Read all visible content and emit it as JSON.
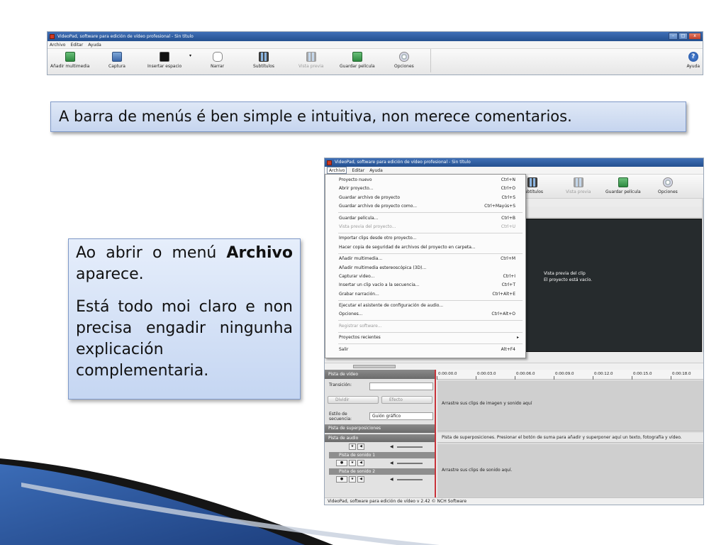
{
  "top_app": {
    "title": "VideoPad, software para edición de vídeo profesional - Sin título",
    "menu": [
      "Archivo",
      "Editar",
      "Ayuda"
    ],
    "toolbar": [
      {
        "label": "Añadir multimedia",
        "icon": "add-media-icon"
      },
      {
        "label": "Captura",
        "icon": "capture-icon"
      },
      {
        "label": "Insertar espacio",
        "icon": "insert-space-icon"
      },
      {
        "label": "Narrar",
        "icon": "narrate-icon"
      },
      {
        "label": "Subtítulos",
        "icon": "subtitles-icon"
      },
      {
        "label": "Vista previa",
        "icon": "preview-icon"
      },
      {
        "label": "Guardar película",
        "icon": "save-movie-icon"
      },
      {
        "label": "Opciones",
        "icon": "options-icon"
      },
      {
        "label": "Ayuda",
        "icon": "help-icon"
      }
    ]
  },
  "banner": {
    "text": "A barra de menús é ben simple e intuitiva, non merece comentarios."
  },
  "textbox": {
    "p1_pre": "Ao abrir o menú ",
    "p1_bold": "Archivo",
    "p1_post": " aparece.",
    "p2": "Está todo moi claro e non precisa engadir ningunha explicación complementaria."
  },
  "shot": {
    "title": "VideoPad, software para edición de vídeo profesional - Sin título",
    "menu": [
      "Archivo",
      "Editar",
      "Ayuda"
    ],
    "toolbar": [
      "Subtítulos",
      "Vista previa",
      "Guardar película",
      "Opciones"
    ],
    "dropdown": [
      {
        "label": "Proyecto nuevo",
        "shortcut": "Ctrl+N"
      },
      {
        "label": "Abrir proyecto...",
        "shortcut": "Ctrl+O"
      },
      {
        "label": "Guardar archivo de proyecto",
        "shortcut": "Ctrl+S"
      },
      {
        "label": "Guardar archivo de proyecto como...",
        "shortcut": "Ctrl+Mayús+S"
      },
      {
        "sep": true
      },
      {
        "label": "Guardar película...",
        "shortcut": "Ctrl+B"
      },
      {
        "label": "Vista previa del proyecto...",
        "shortcut": "Ctrl+U",
        "disabled": true
      },
      {
        "sep": true
      },
      {
        "label": "Importar clips desde otro proyecto...",
        "shortcut": ""
      },
      {
        "label": "Hacer copia de seguridad de archivos del proyecto en carpeta...",
        "shortcut": ""
      },
      {
        "sep": true
      },
      {
        "label": "Añadir multimedia...",
        "shortcut": "Ctrl+M"
      },
      {
        "label": "Añadir multimedia estereoscópica (3D)...",
        "shortcut": ""
      },
      {
        "label": "Capturar video...",
        "shortcut": "Ctrl+I"
      },
      {
        "label": "Insertar un clip vacío a la secuencia...",
        "shortcut": "Ctrl+T"
      },
      {
        "label": "Grabar narración...",
        "shortcut": "Ctrl+Alt+E"
      },
      {
        "sep": true
      },
      {
        "label": "Ejecutar el asistente de configuración de audio...",
        "shortcut": ""
      },
      {
        "label": "Opciones...",
        "shortcut": "Ctrl+Alt+O"
      },
      {
        "sep": true
      },
      {
        "label": "Registrar software...",
        "shortcut": "",
        "disabled": true
      },
      {
        "sep": true
      },
      {
        "label": "Proyectos recientes",
        "shortcut": "",
        "submenu": true
      },
      {
        "sep": true
      },
      {
        "label": "Salir",
        "shortcut": "Alt+F4"
      }
    ],
    "preview_text": [
      "Vista previa del clip",
      "El proyecto está vacío."
    ],
    "timeline": [
      "0:00:00.0",
      "0:00:03.0",
      "0:00:06.0",
      "0:00:09.0",
      "0:00:12.0",
      "0:00:15.0",
      "0:00:18.0"
    ],
    "panel": {
      "video_track": "Pista de vídeo",
      "transition_label": "Transición:",
      "split_button": "Dividir",
      "effect_button": "Efecto",
      "style_label": "Estilo de secuencia:",
      "style_value": "Guión gráfico",
      "overlay_track": "Pista de superposiciones",
      "audio_track": "Pista de audio",
      "sound1": "Pista de sonido 1",
      "sound2": "Pista de sonido 2"
    },
    "tracks": {
      "video_hint": "Arrastre sus clips de imagen y sonido aquí",
      "overlay_hint": "Pista de superposiciones. Presionar el botón de suma para añadir y superponer aquí un texto, fotografía y vídeo.",
      "audio_hint": "Arrastre sus clips de sonido aquí."
    },
    "status": "VideoPad, software para edición de vídeo v 2.42 © NCH Software"
  },
  "colors": {
    "banner_bg": "#d3dff3",
    "banner_border": "#7f99c8",
    "swoosh_dark": "#1a1a1a",
    "swoosh_blue": "#2f5aa8"
  }
}
